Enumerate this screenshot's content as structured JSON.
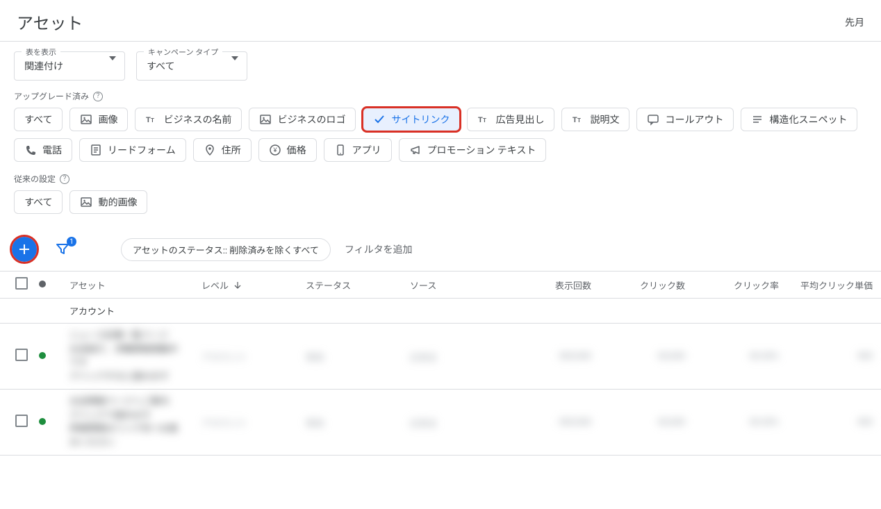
{
  "header": {
    "title": "アセット",
    "date_range": "先月"
  },
  "dropdowns": {
    "table_view": {
      "label": "表を表示",
      "value": "関連付け"
    },
    "campaign_type": {
      "label": "キャンペーン タイプ",
      "value": "すべて"
    }
  },
  "sections": {
    "upgraded": {
      "label": "アップグレード済み",
      "chips": [
        {
          "text": "すべて",
          "icon": null
        },
        {
          "text": "画像",
          "icon": "image"
        },
        {
          "text": "ビジネスの名前",
          "icon": "tt"
        },
        {
          "text": "ビジネスのロゴ",
          "icon": "image"
        },
        {
          "text": "サイトリンク",
          "icon": "check",
          "selected": true,
          "highlight": true
        },
        {
          "text": "広告見出し",
          "icon": "tt"
        },
        {
          "text": "説明文",
          "icon": "tt"
        },
        {
          "text": "コールアウト",
          "icon": "callout"
        },
        {
          "text": "構造化スニペット",
          "icon": "list"
        },
        {
          "text": "電話",
          "icon": "phone"
        },
        {
          "text": "リードフォーム",
          "icon": "form"
        },
        {
          "text": "住所",
          "icon": "pin"
        },
        {
          "text": "価格",
          "icon": "price"
        },
        {
          "text": "アプリ",
          "icon": "app"
        },
        {
          "text": "プロモーション テキスト",
          "icon": "promo"
        }
      ]
    },
    "legacy": {
      "label": "従来の設定",
      "chips": [
        {
          "text": "すべて",
          "icon": null
        },
        {
          "text": "動的画像",
          "icon": "image"
        }
      ]
    }
  },
  "toolbar": {
    "filter_count": "1",
    "filter_pill": "アセットのステータス:: 削除済みを除くすべて",
    "add_filter": "フィルタを追加"
  },
  "table": {
    "columns": {
      "asset": "アセット",
      "level": "レベル",
      "status": "ステータス",
      "source": "ソース",
      "impressions": "表示回数",
      "clicks": "クリック数",
      "ctr": "クリック率",
      "avg_cpc": "平均クリック単価"
    },
    "group_row": "アカウント",
    "rows": [
      {
        "asset": "ニュース記事一覧ページ\nお店紹介、求職情報掲載中です\nクリックすると進みます",
        "level": "アカウント",
        "status": "有効",
        "source": "広告主",
        "impressions": "000,000",
        "clicks": "00,000",
        "ctr": "00.00%",
        "avg_cpc": "¥00"
      },
      {
        "asset": "お店情報ページへご案内\nクリックで進めます\n詳細情報はリンク先へお進みください",
        "level": "アカウント",
        "status": "有効",
        "source": "広告主",
        "impressions": "000,000",
        "clicks": "00,000",
        "ctr": "00.00%",
        "avg_cpc": "¥00"
      }
    ]
  }
}
